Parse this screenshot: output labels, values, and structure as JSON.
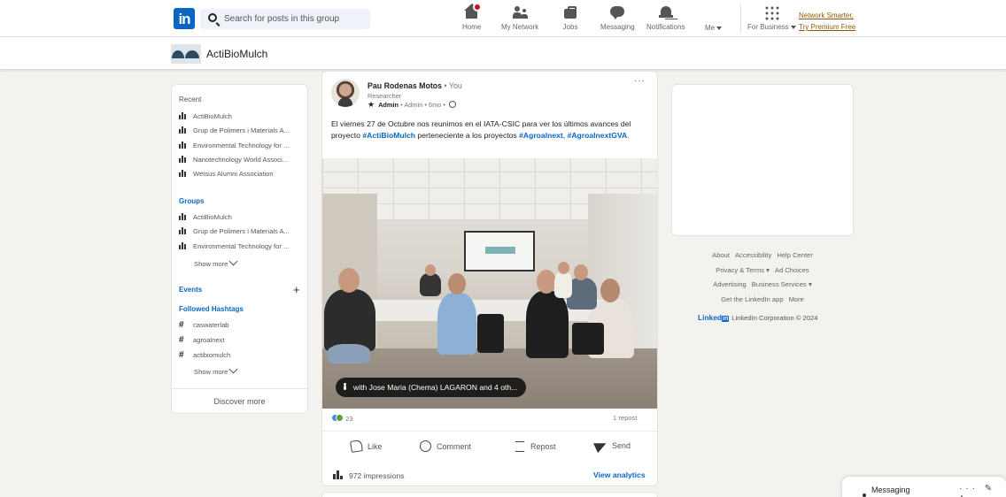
{
  "nav": {
    "logo_text": "in",
    "search_placeholder": "Search for posts in this group",
    "items": [
      {
        "label": "Home"
      },
      {
        "label": "My Network"
      },
      {
        "label": "Jobs"
      },
      {
        "label": "Messaging"
      },
      {
        "label": "Notifications"
      },
      {
        "label": "Me"
      },
      {
        "label": "For Business"
      }
    ],
    "premium_line1": "Network Smarter,",
    "premium_line2": "Try Premium Free"
  },
  "group": {
    "name": "ActiBioMulch"
  },
  "sidebar": {
    "recent_title": "Recent",
    "recent": [
      "ActiBioMulch",
      "Grup de Polimers i Materials A...",
      "Environmental Technology for ...",
      "Nanotechnology World Associ...",
      "Wetsus Alumni Association"
    ],
    "groups_title": "Groups",
    "groups": [
      "ActiBioMulch",
      "Grup de Polimers i Materials A...",
      "Environmental Technology for ..."
    ],
    "show_more": "Show more",
    "events_title": "Events",
    "hashtags_title": "Followed Hashtags",
    "hashtags": [
      "caswaterlab",
      "agroalnext",
      "actibiomulch"
    ],
    "discover": "Discover more"
  },
  "post": {
    "author": "Pau Rodenas Motos",
    "you": " • You",
    "role": "Researcher",
    "admin": "Admin",
    "meta": " • Admin • 6mo • ",
    "text_1": "El viernes 27 de Octubre nos reunimos en el IATA-CSIC para ver los últimos avances del proyecto ",
    "tag_1": "#ActiBioMulch",
    "text_2": " perteneciente a los proyectos ",
    "tag_2": "#Agroalnext",
    "text_3": ", ",
    "tag_3": "#AgroalnextGVA",
    "text_4": ".",
    "with_tag": "with Jose Maria (Chema) LAGARON and 4 oth...",
    "reactions": "23",
    "reposts": "1 repost",
    "actions": [
      "Like",
      "Comment",
      "Repost",
      "Send"
    ],
    "impressions": "972 impressions",
    "analytics": "View analytics"
  },
  "footer": {
    "links_row1": [
      "About",
      "Accessibility",
      "Help Center"
    ],
    "links_row2": [
      "Privacy & Terms ▾",
      "Ad Choices"
    ],
    "links_row3": [
      "Advertising",
      "Business Services ▾"
    ],
    "links_row4": [
      "Get the LinkedIn app",
      "More"
    ],
    "brand": "Linked",
    "brand_in": "in",
    "copyright": "LinkedIn Corporation © 2024"
  },
  "messaging": {
    "title": "Messaging",
    "icons": "··· ✎ ˄"
  },
  "colors": {
    "brand": "#0a66c2",
    "premium": "#915907",
    "notification": "#cb112d"
  }
}
